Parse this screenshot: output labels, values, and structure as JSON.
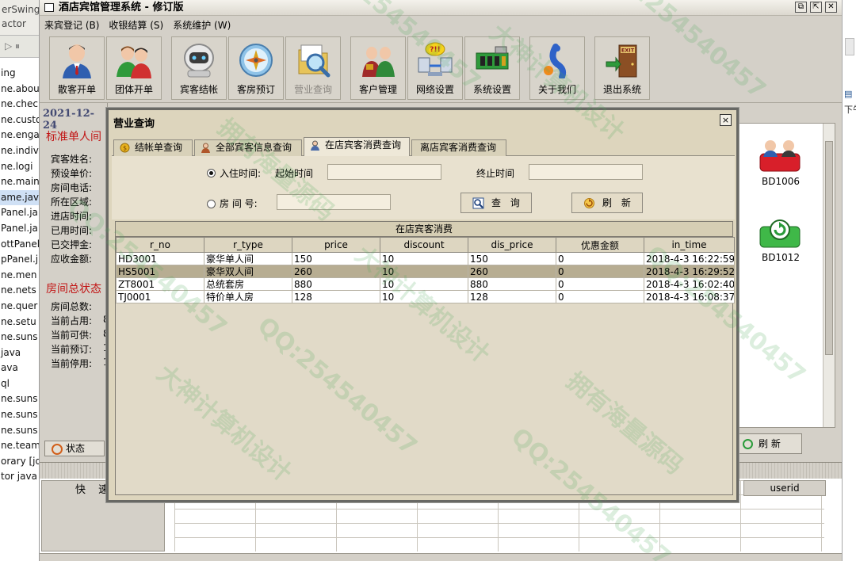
{
  "ide": {
    "header_lines": [
      "erSwing",
      "actor"
    ],
    "file_list": [
      "ing",
      "ne.abou",
      "ne.chec",
      "ne.custo",
      "ne.enga",
      "ne.indiv",
      "ne.logi",
      "ne.main",
      "ame.java",
      "Panel.ja",
      "Panel.ja",
      "ottPanel.j",
      "pPanel.j",
      "ne.men",
      "ne.nets",
      "ne.quer",
      "ne.setu",
      "ne.suns",
      "java",
      "ava",
      "ql",
      "ne.suns",
      "ne.suns",
      "ne.suns",
      "ne.team",
      "orary [jd",
      "tor java"
    ],
    "right_text": "下午"
  },
  "app": {
    "title": "酒店宾馆管理系统 - 修订版",
    "menu": [
      "来宾登记 (B)",
      "收银结算 (S)",
      "系统维护 (W)"
    ],
    "toolbar": [
      {
        "label": "散客开单",
        "icon": "person-icon"
      },
      {
        "label": "团体开单",
        "icon": "group-icon"
      },
      {
        "label": "宾客结帐",
        "icon": "robot-icon"
      },
      {
        "label": "客房预订",
        "icon": "compass-icon"
      },
      {
        "label": "营业查询",
        "icon": "search-folder-icon"
      },
      {
        "label": "客户管理",
        "icon": "customers-icon"
      },
      {
        "label": "网络设置",
        "icon": "network-icon"
      },
      {
        "label": "系统设置",
        "icon": "system-board-icon"
      },
      {
        "label": "关于我们",
        "icon": "about-icon"
      },
      {
        "label": "退出系统",
        "icon": "exit-door-icon"
      }
    ],
    "background": {
      "date": "2021-12-24",
      "room_section": "标准单人间",
      "room_fields": [
        "宾客姓名:",
        "预设单价:",
        "房间电话:",
        "所在区域:",
        "进店时间:",
        "已用时间:",
        "已交押金:",
        "应收金额:"
      ],
      "status_section": "房间总状态",
      "status_fields": [
        "房间总数:",
        "当前占用:",
        "当前可供:",
        "当前预订:",
        "当前停用:"
      ],
      "status_values": [
        "",
        "8",
        "8",
        "1",
        "1"
      ],
      "status_tab": "状态",
      "rooms": [
        {
          "label": "BD1006"
        },
        {
          "label": "BD1012"
        }
      ],
      "refresh_label": "刷 新",
      "quick_label": "快 速",
      "userid_label": "userid"
    }
  },
  "dialog": {
    "title": "营业查询",
    "close_label": "×",
    "tabs": [
      "结帐单查询",
      "全部宾客信息查询",
      "在店宾客消费查询",
      "离店宾客消费查询"
    ],
    "active_tab": 2,
    "query": {
      "checkin_radio": "入住时间:",
      "start_label": "起始时间",
      "end_label": "终止时间",
      "room_radio": "房 间 号:",
      "start_value": "",
      "end_value": "",
      "room_value": "",
      "search_label": "查 询",
      "refresh_label": "刷 新"
    },
    "table": {
      "caption": "在店宾客消费",
      "columns": [
        "r_no",
        "r_type",
        "price",
        "discount",
        "dis_price",
        "优惠金额",
        "in_time"
      ],
      "rows": [
        [
          "HD3001",
          "豪华单人间",
          "150",
          "10",
          "150",
          "0",
          "2018-4-3 16:22:59"
        ],
        [
          "HS5001",
          "豪华双人间",
          "260",
          "10",
          "260",
          "0",
          "2018-4-3 16:29:52"
        ],
        [
          "ZT8001",
          "总统套房",
          "880",
          "10",
          "880",
          "0",
          "2018-4-3 16:02:40"
        ],
        [
          "TJ0001",
          "特价单人房",
          "128",
          "10",
          "128",
          "0",
          "2018-4-3 16:08:37"
        ]
      ],
      "selected_row": 1
    }
  },
  "watermarks": [
    "QQ:254540457",
    "大神计算机设计",
    "拥有海量源码"
  ],
  "colors": {
    "dialog_bg": "#ddd5bd",
    "selected_row": "#b7ad92",
    "section_red": "#c21515",
    "date_blue": "#434a73"
  }
}
